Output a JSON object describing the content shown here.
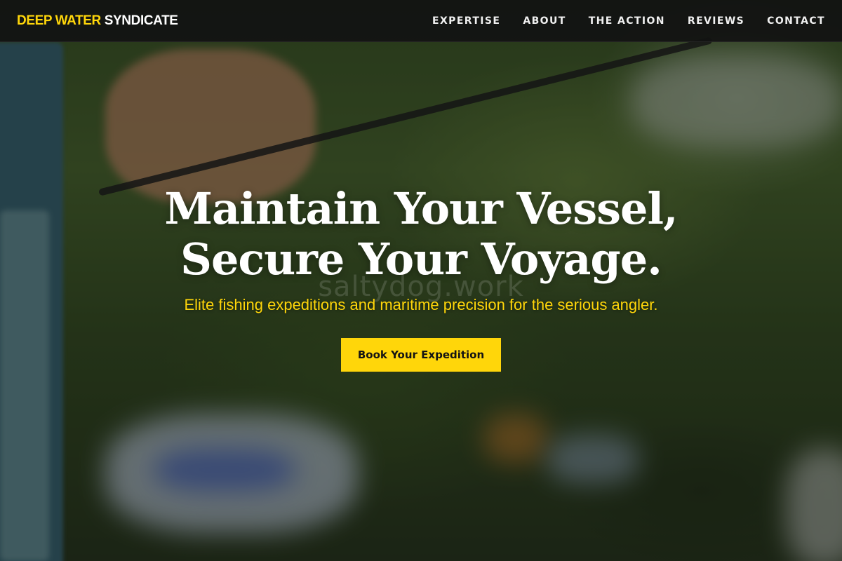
{
  "brand": {
    "accent": "DEEP WATER",
    "rest": "SYNDICATE"
  },
  "nav": {
    "items": [
      {
        "label": "EXPERTISE"
      },
      {
        "label": "ABOUT"
      },
      {
        "label": "THE ACTION"
      },
      {
        "label": "REVIEWS"
      },
      {
        "label": "CONTACT"
      }
    ]
  },
  "hero": {
    "headline_line1": "Maintain Your Vessel,",
    "headline_line2": "Secure Your Voyage.",
    "subtitle": "Elite fishing expeditions and maritime precision for the serious angler.",
    "cta_label": "Book Your Expedition",
    "watermark": "saltydog.work"
  },
  "colors": {
    "accent": "#ffd60a",
    "nav_bg": "#121212",
    "text": "#ffffff"
  }
}
